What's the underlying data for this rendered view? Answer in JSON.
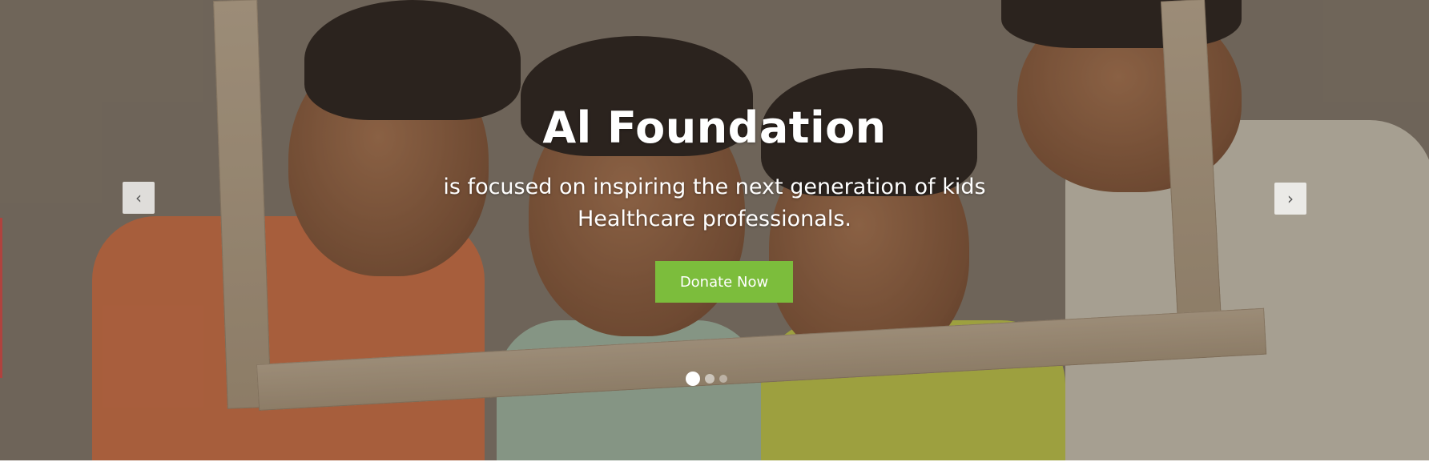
{
  "hero": {
    "title": "Al Foundation",
    "subtitle_line1": "is focused on inspiring the next generation of  kids",
    "subtitle_line2": "Healthcare professionals.",
    "cta_label": "Donate Now",
    "cta_color": "#7cbd3c",
    "prev_icon": "‹",
    "next_icon": "›",
    "slides_count": 3,
    "active_slide": 1
  }
}
